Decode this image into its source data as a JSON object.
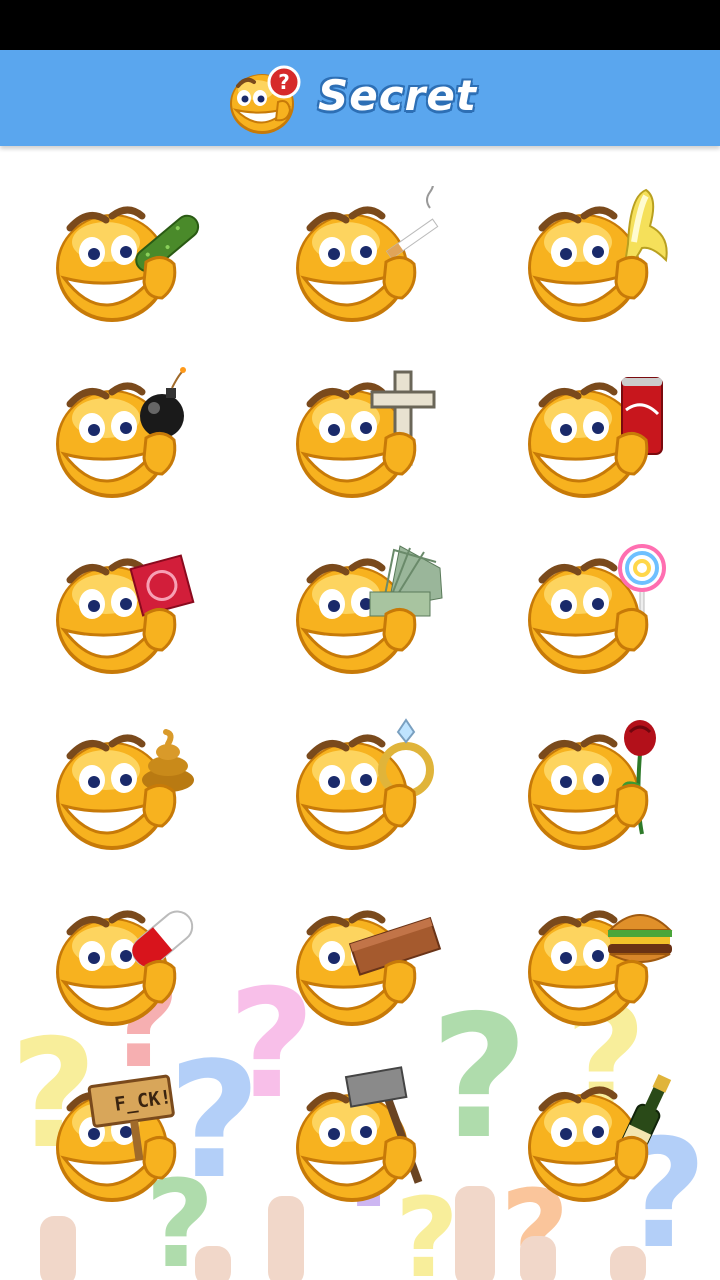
{
  "header": {
    "title": "Secret",
    "background_color": "#5aa6ee",
    "logo_icon": "question-emoji-icon"
  },
  "stickers": [
    {
      "name": "Cucumber",
      "icon": "cucumber-icon"
    },
    {
      "name": "Cigarette",
      "icon": "cigarette-icon"
    },
    {
      "name": "Banana",
      "icon": "banana-icon"
    },
    {
      "name": "Bomb",
      "icon": "bomb-icon"
    },
    {
      "name": "Cross",
      "icon": "cross-icon"
    },
    {
      "name": "Cola",
      "icon": "soda-can-icon"
    },
    {
      "name": "Condom",
      "icon": "condom-icon"
    },
    {
      "name": "Money",
      "icon": "money-icon"
    },
    {
      "name": "Lollipop",
      "icon": "lollipop-icon"
    },
    {
      "name": "Poop",
      "icon": "poop-icon"
    },
    {
      "name": "Ring",
      "icon": "ring-icon"
    },
    {
      "name": "Rose",
      "icon": "rose-icon"
    },
    {
      "name": "Pill",
      "icon": "pill-icon"
    },
    {
      "name": "Brick",
      "icon": "brick-icon"
    },
    {
      "name": "Burger",
      "icon": "burger-icon"
    },
    {
      "name": "F_CK! sign",
      "icon": "sign-icon",
      "sign_text": "F_CK!"
    },
    {
      "name": "Hammer",
      "icon": "hammer-icon"
    },
    {
      "name": "Champagne",
      "icon": "champagne-icon"
    }
  ],
  "colors": {
    "face": "#f7b21f",
    "face_highlight": "#ffe27a",
    "face_outline": "#c77a08",
    "eyebrow": "#7a4a1c",
    "eye_pupil": "#1a2a6a",
    "mouth_teeth": "#ffffff",
    "statusbar": "#000000"
  }
}
